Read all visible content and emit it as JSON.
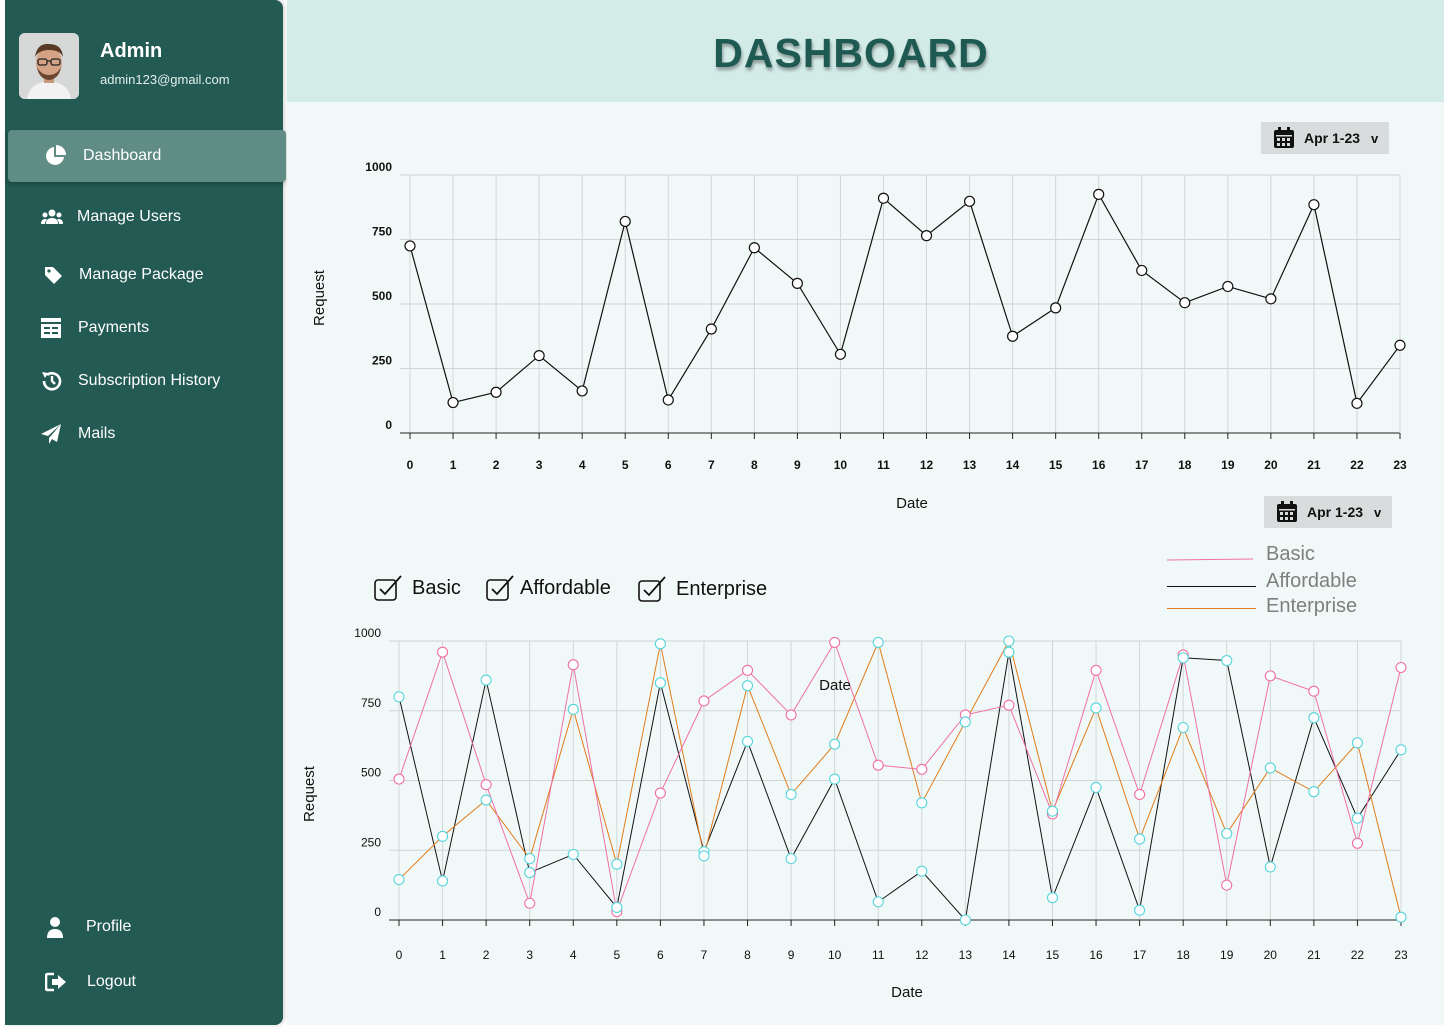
{
  "sidebar": {
    "user": {
      "name": "Admin",
      "email": "admin123@gmail.com"
    },
    "items": [
      {
        "label": "Dashboard",
        "icon": "pie-chart-icon",
        "active": true
      },
      {
        "label": "Manage Users",
        "icon": "users-icon"
      },
      {
        "label": "Manage Package",
        "icon": "tag-icon"
      },
      {
        "label": "Payments",
        "icon": "payments-icon"
      },
      {
        "label": "Subscription History",
        "icon": "history-icon"
      },
      {
        "label": "Mails",
        "icon": "send-icon"
      }
    ],
    "bottom_items": [
      {
        "label": "Profile",
        "icon": "user-icon"
      },
      {
        "label": "Logout",
        "icon": "logout-icon"
      }
    ]
  },
  "header": {
    "title": "DASHBOARD"
  },
  "date_picker_1": {
    "label": "Apr 1-23",
    "caret": "v"
  },
  "date_picker_2": {
    "label": "Apr 1-23",
    "caret": "v"
  },
  "filters": [
    {
      "label": "Basic",
      "checked": true
    },
    {
      "label": "Affordable",
      "checked": true
    },
    {
      "label": "Enterprise",
      "checked": true
    }
  ],
  "colors": {
    "sidebar": "#235a53",
    "basic": "#f06fa4",
    "affordable": "#111111",
    "enterprise": "#e07b1a",
    "markers_cyan": "#57d5dc"
  },
  "chart_data": [
    {
      "type": "line",
      "title": "",
      "xlabel": "Date",
      "ylabel": "Request",
      "ylim": [
        0,
        1000
      ],
      "yticks": [
        0,
        250,
        500,
        750,
        1000
      ],
      "x": [
        0,
        1,
        2,
        3,
        4,
        5,
        6,
        7,
        8,
        9,
        10,
        11,
        12,
        13,
        14,
        15,
        16,
        17,
        18,
        19,
        20,
        21,
        22,
        23
      ],
      "series": [
        {
          "values": [
            725,
            118,
            158,
            300,
            163,
            820,
            128,
            403,
            718,
            580,
            305,
            910,
            765,
            898,
            375,
            485,
            925,
            630,
            505,
            568,
            520,
            885,
            115,
            340
          ]
        }
      ],
      "grid": true
    },
    {
      "type": "line",
      "title": "",
      "xlabel": "Date",
      "ylabel": "Request",
      "annotation": "Date",
      "ylim": [
        0,
        1000
      ],
      "yticks": [
        0,
        250,
        500,
        750,
        1000
      ],
      "x": [
        0,
        1,
        2,
        3,
        4,
        5,
        6,
        7,
        8,
        9,
        10,
        11,
        12,
        13,
        14,
        15,
        16,
        17,
        18,
        19,
        20,
        21,
        22,
        23
      ],
      "legend": [
        "Basic",
        "Affordable",
        "Enterprise"
      ],
      "legend_position": "top-right",
      "series": [
        {
          "name": "Basic",
          "values": [
            505,
            960,
            485,
            60,
            915,
            30,
            455,
            785,
            895,
            735,
            995,
            555,
            540,
            735,
            770,
            380,
            895,
            450,
            950,
            125,
            875,
            820,
            275,
            905
          ]
        },
        {
          "name": "Affordable",
          "values": [
            800,
            140,
            860,
            170,
            235,
            45,
            850,
            245,
            640,
            220,
            505,
            65,
            175,
            0,
            960,
            80,
            475,
            35,
            940,
            930,
            190,
            725,
            365,
            610
          ]
        },
        {
          "name": "Enterprise",
          "values": [
            145,
            300,
            430,
            220,
            755,
            200,
            990,
            230,
            840,
            450,
            630,
            995,
            420,
            710,
            1000,
            390,
            760,
            290,
            690,
            310,
            545,
            460,
            635,
            10
          ]
        }
      ],
      "grid": true
    }
  ]
}
